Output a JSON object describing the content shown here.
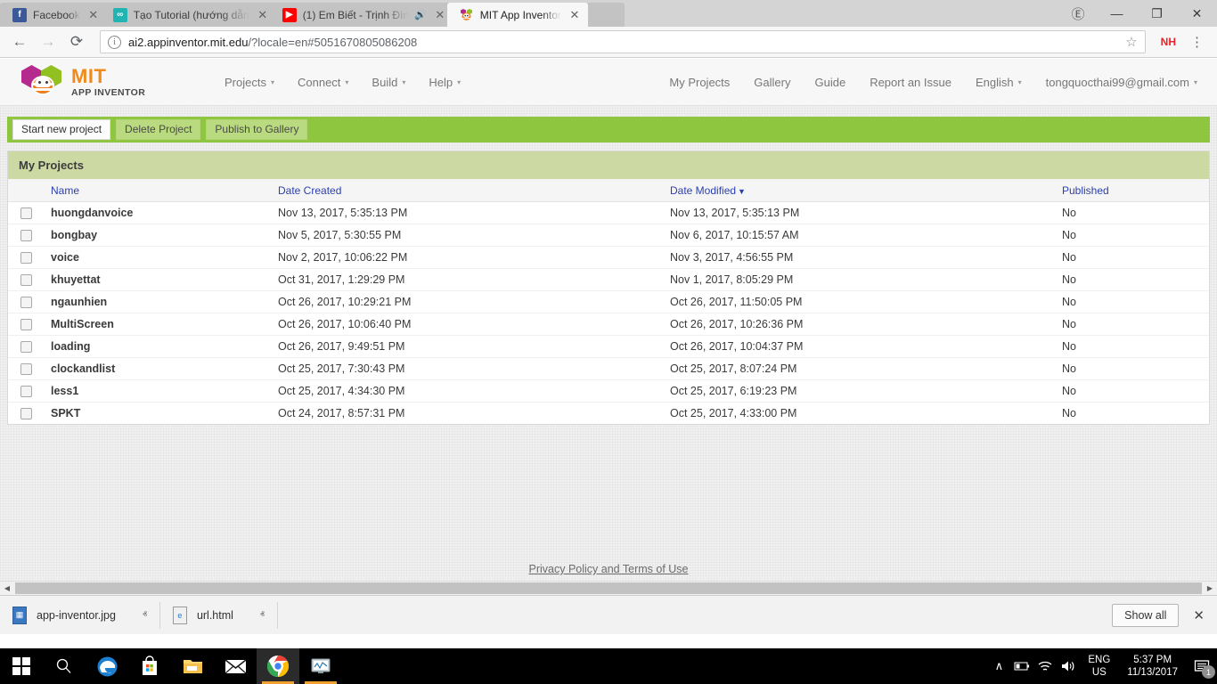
{
  "browser": {
    "tabs": [
      {
        "title": "Facebook",
        "favicon": "facebook-icon",
        "favicon_glyph": "f",
        "active": false,
        "audio": false
      },
      {
        "title": "Tạo Tutorial (hướng dẫn",
        "favicon": "teal-circle-icon",
        "favicon_glyph": "∞",
        "active": false,
        "audio": false
      },
      {
        "title": "(1) Em Biết - Trịnh Đìn",
        "favicon": "youtube-icon",
        "favicon_glyph": "▶",
        "active": false,
        "audio": true
      },
      {
        "title": "MIT App Inventor",
        "favicon": "app-inventor-icon",
        "favicon_glyph": "",
        "active": true,
        "audio": false
      }
    ],
    "tab_close_glyph": "✕",
    "audio_glyph": "🔊",
    "window_controls": {
      "minimize": "—",
      "maximize": "❐",
      "close": "✕"
    },
    "profile_icon": "Ⓔ",
    "nav": {
      "back": "←",
      "forward": "→",
      "reload": "⟳"
    },
    "url": {
      "info_glyph": "i",
      "domain": "ai2.appinventor.mit.edu",
      "rest": "/?locale=en#5051670805086208",
      "full": "ai2.appinventor.mit.edu/?locale=en#5051670805086208"
    },
    "star_glyph": "☆",
    "extension_badge": "NH",
    "menu_glyph": "⋮"
  },
  "app": {
    "logo": {
      "title": "MIT",
      "subtitle": "APP INVENTOR"
    },
    "nav_left": [
      {
        "label": "Projects",
        "caret": "▾"
      },
      {
        "label": "Connect",
        "caret": "▾"
      },
      {
        "label": "Build",
        "caret": "▾"
      },
      {
        "label": "Help",
        "caret": "▾"
      }
    ],
    "nav_right": [
      {
        "label": "My Projects",
        "caret": ""
      },
      {
        "label": "Gallery",
        "caret": ""
      },
      {
        "label": "Guide",
        "caret": ""
      },
      {
        "label": "Report an Issue",
        "caret": ""
      },
      {
        "label": "English",
        "caret": "▾"
      },
      {
        "label": "tongquocthai99@gmail.com",
        "caret": "▾"
      }
    ],
    "toolbar": {
      "start_new_project": "Start new project",
      "delete_project": "Delete Project",
      "publish_to_gallery": "Publish to Gallery"
    },
    "panel_title": "My Projects",
    "table": {
      "headers": {
        "name": "Name",
        "date_created": "Date Created",
        "date_modified": "Date Modified",
        "published": "Published"
      },
      "sort_caret": "▼",
      "rows": [
        {
          "name": "huongdanvoice",
          "created": "Nov 13, 2017, 5:35:13 PM",
          "modified": "Nov 13, 2017, 5:35:13 PM",
          "published": "No"
        },
        {
          "name": "bongbay",
          "created": "Nov 5, 2017, 5:30:55 PM",
          "modified": "Nov 6, 2017, 10:15:57 AM",
          "published": "No"
        },
        {
          "name": "voice",
          "created": "Nov 2, 2017, 10:06:22 PM",
          "modified": "Nov 3, 2017, 4:56:55 PM",
          "published": "No"
        },
        {
          "name": "khuyettat",
          "created": "Oct 31, 2017, 1:29:29 PM",
          "modified": "Nov 1, 2017, 8:05:29 PM",
          "published": "No"
        },
        {
          "name": "ngaunhien",
          "created": "Oct 26, 2017, 10:29:21 PM",
          "modified": "Oct 26, 2017, 11:50:05 PM",
          "published": "No"
        },
        {
          "name": "MultiScreen",
          "created": "Oct 26, 2017, 10:06:40 PM",
          "modified": "Oct 26, 2017, 10:26:36 PM",
          "published": "No"
        },
        {
          "name": "loading",
          "created": "Oct 26, 2017, 9:49:51 PM",
          "modified": "Oct 26, 2017, 10:04:37 PM",
          "published": "No"
        },
        {
          "name": "clockandlist",
          "created": "Oct 25, 2017, 7:30:43 PM",
          "modified": "Oct 25, 2017, 8:07:24 PM",
          "published": "No"
        },
        {
          "name": "less1",
          "created": "Oct 25, 2017, 4:34:30 PM",
          "modified": "Oct 25, 2017, 6:19:23 PM",
          "published": "No"
        },
        {
          "name": "SPKT",
          "created": "Oct 24, 2017, 8:57:31 PM",
          "modified": "Oct 25, 2017, 4:33:00 PM",
          "published": "No"
        }
      ]
    },
    "footer_link": "Privacy Policy and Terms of Use"
  },
  "downloads": {
    "items": [
      {
        "filename": "app-inventor.jpg",
        "icon": "image-file-icon",
        "caret": "ⱏ"
      },
      {
        "filename": "url.html",
        "icon": "html-file-icon",
        "caret": "ⱏ"
      }
    ],
    "show_all": "Show all",
    "close_glyph": "✕"
  },
  "taskbar": {
    "icons": [
      {
        "name": "start-button",
        "glyph": ""
      },
      {
        "name": "search-icon",
        "glyph": "⚲"
      },
      {
        "name": "edge-icon",
        "glyph": "e"
      },
      {
        "name": "store-icon",
        "glyph": ""
      },
      {
        "name": "file-explorer-icon",
        "glyph": ""
      },
      {
        "name": "mail-icon",
        "glyph": "✉"
      },
      {
        "name": "chrome-icon",
        "glyph": ""
      },
      {
        "name": "monitor-app-icon",
        "glyph": ""
      }
    ],
    "tray": {
      "chevron": "∧",
      "battery": "▭",
      "wifi": "◠",
      "volume": "🔊",
      "language_line1": "ENG",
      "language_line2": "US",
      "time": "5:37 PM",
      "date": "11/13/2017",
      "notification_count": "1"
    }
  },
  "colors": {
    "green_toolbar": "#8ec640",
    "panel_header": "#cdd9a3",
    "link_blue": "#2a3fb0",
    "logo_orange": "#f08a1c"
  }
}
